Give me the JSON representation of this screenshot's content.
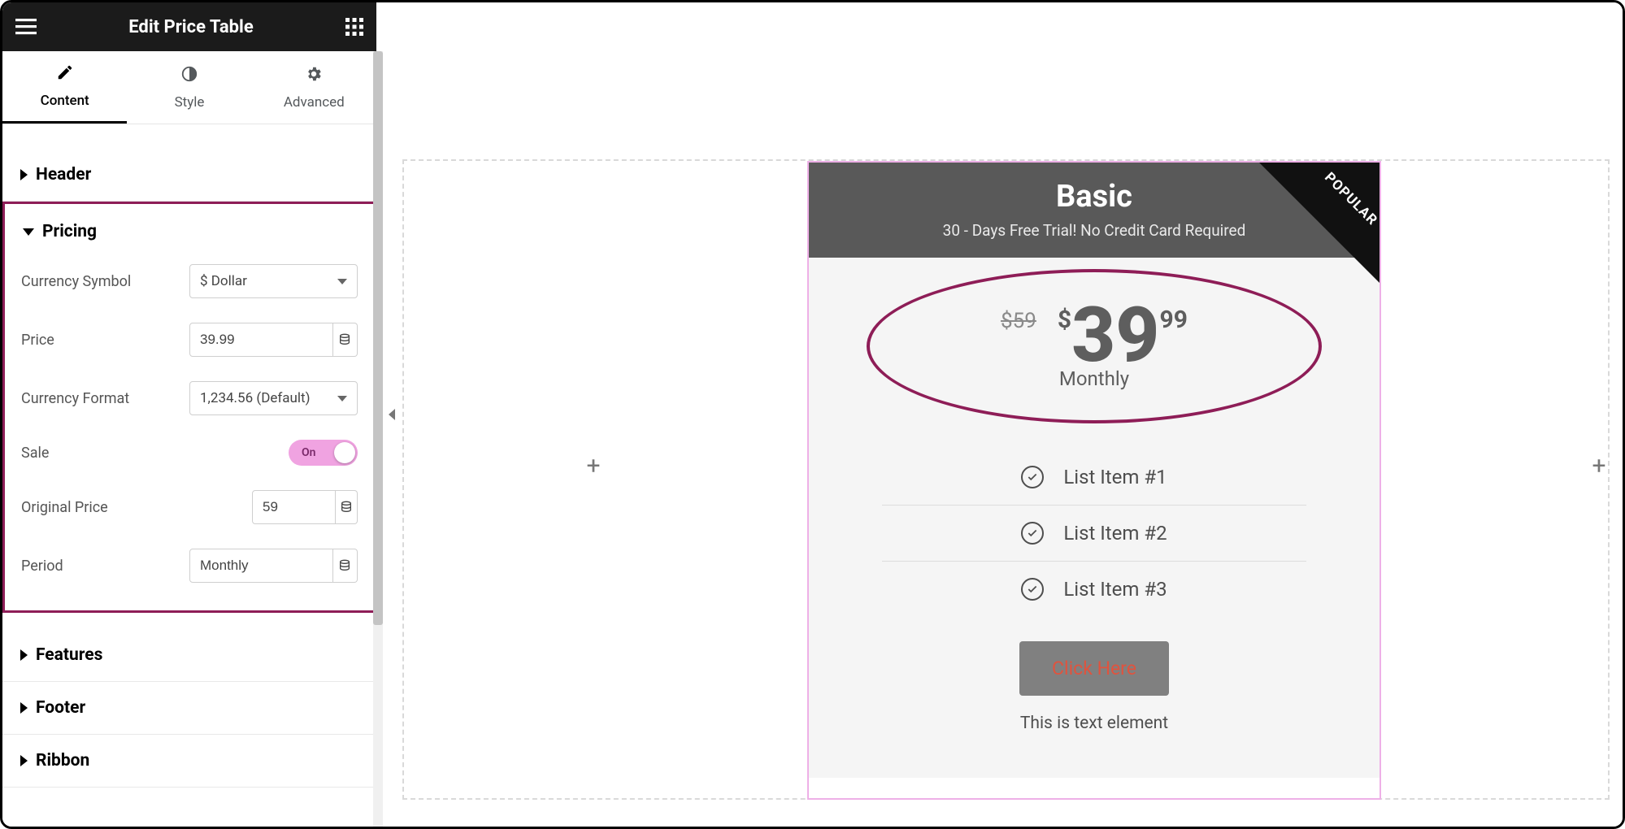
{
  "window": {
    "title": "Edit Price Table"
  },
  "tabs": {
    "content": "Content",
    "style": "Style",
    "advanced": "Advanced",
    "active": "content"
  },
  "sections": {
    "header": "Header",
    "pricing": "Pricing",
    "features": "Features",
    "footer": "Footer",
    "ribbon": "Ribbon"
  },
  "pricing": {
    "currency_symbol": {
      "label": "Currency Symbol",
      "value": "$ Dollar"
    },
    "price": {
      "label": "Price",
      "value": "39.99"
    },
    "currency_format": {
      "label": "Currency Format",
      "value": "1,234.56 (Default)"
    },
    "sale": {
      "label": "Sale",
      "state": "On"
    },
    "original_price": {
      "label": "Original Price",
      "value": "59"
    },
    "period": {
      "label": "Period",
      "value": "Monthly"
    }
  },
  "card": {
    "title": "Basic",
    "subtitle": "30 - Days Free Trial! No Credit Card Required",
    "ribbon": "POPULAR",
    "original_price": "$59",
    "currency": "$",
    "price_int": "39",
    "price_frac": "99",
    "period": "Monthly",
    "features": [
      "List Item #1",
      "List Item #2",
      "List Item #3"
    ],
    "cta": "Click Here",
    "footer_text": "This is text element"
  },
  "colors": {
    "highlight": "#8e1d57",
    "toggle_bg": "#f0a3e1"
  }
}
